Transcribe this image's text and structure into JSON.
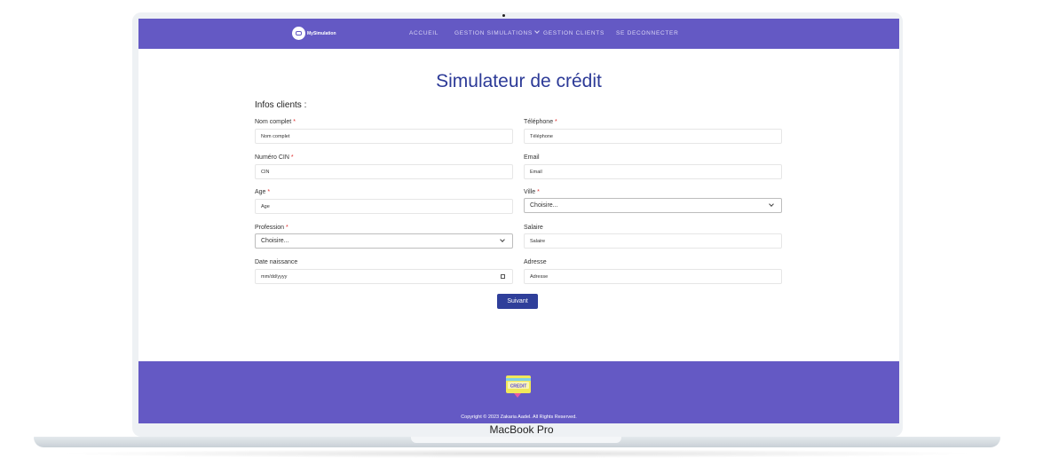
{
  "device": {
    "label": "MacBook Pro"
  },
  "nav": {
    "brand": "MySimulation",
    "items": [
      {
        "label": "ACCUEIL"
      },
      {
        "label": "GESTION SIMULATIONS"
      },
      {
        "label": "GESTION CLIENTS"
      },
      {
        "label": "SE DECONNECTER"
      }
    ]
  },
  "page": {
    "title": "Simulateur de crédit",
    "section": "Infos clients :"
  },
  "form": {
    "nom": {
      "label": "Nom complet",
      "required": "*",
      "placeholder": "Nom complet"
    },
    "telephone": {
      "label": "Téléphone",
      "required": "*",
      "placeholder": "Téléphone"
    },
    "cin": {
      "label": "Numéro CIN",
      "required": "*",
      "placeholder": "CIN"
    },
    "email": {
      "label": "Email",
      "placeholder": "Email"
    },
    "age": {
      "label": "Age",
      "required": "*",
      "placeholder": "Age"
    },
    "ville": {
      "label": "Ville",
      "required": "*",
      "value": "Choisire..."
    },
    "profession": {
      "label": "Profession",
      "required": "*",
      "value": "Choisire..."
    },
    "salaire": {
      "label": "Salaire",
      "placeholder": "Salaire"
    },
    "date": {
      "label": "Date naissance",
      "placeholder": "mm/dd/yyyy"
    },
    "adresse": {
      "label": "Adresse",
      "placeholder": "Adresse"
    },
    "submit_label": "Suivant"
  },
  "footer": {
    "badge_text": "CREDIT",
    "copyright": "Copyright © 2023 Zakaria Aadel. All Rights Reserved."
  },
  "colors": {
    "nav_bg": "#6459c4",
    "title": "#2c3a97",
    "button": "#2f3f9a",
    "required": "#e02f2f"
  }
}
